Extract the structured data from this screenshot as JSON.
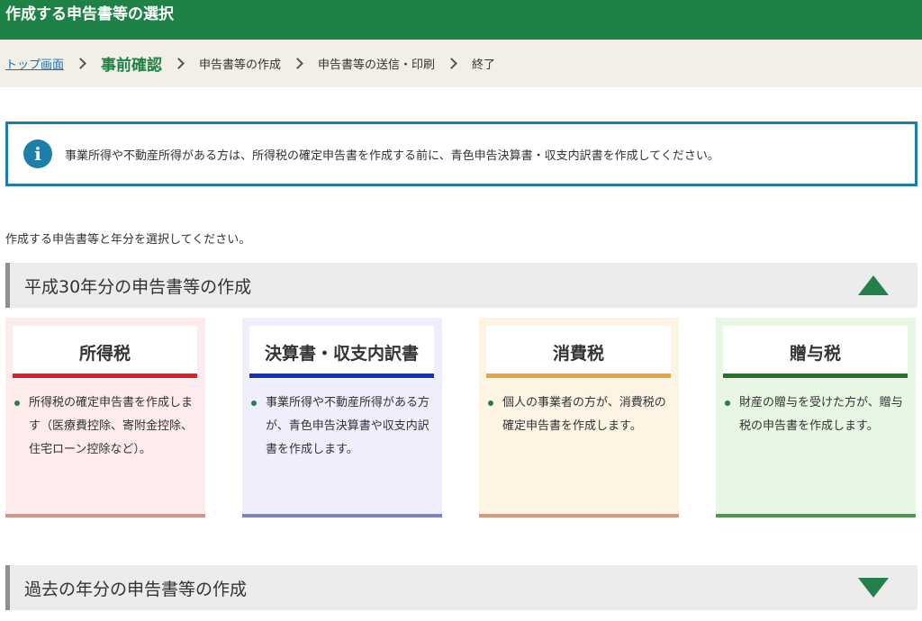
{
  "header": {
    "title": "作成する申告書等の選択"
  },
  "breadcrumb": {
    "items": [
      {
        "label": "トップ画面"
      },
      {
        "label": "事前確認"
      },
      {
        "label": "申告書等の作成"
      },
      {
        "label": "申告書等の送信・印刷"
      },
      {
        "label": "終了"
      }
    ]
  },
  "notice": {
    "icon": "info-icon",
    "icon_glyph": "i",
    "text": "事業所得や不動産所得がある方は、所得税の確定申告書を作成する前に、青色申告決算書・収支内訳書を作成してください。"
  },
  "instruction": "作成する申告書等と年分を選択してください。",
  "sections": [
    {
      "title": "平成30年分の申告書等の作成",
      "state": "expanded"
    },
    {
      "title": "過去の年分の申告書等の作成",
      "state": "collapsed"
    }
  ],
  "cards": [
    {
      "title": "所得税",
      "description": "所得税の確定申告書を作成します（医療費控除、寄附金控除、住宅ローン控除など）。",
      "colors": {
        "background": "#fdeceb",
        "accent": "#dd2027",
        "bottom": "#d5938e"
      }
    },
    {
      "title": "決算書・収支内訳書",
      "description": "事業所得や不動産所得がある方が、青色申告決算書や収支内訳書を作成します。",
      "colors": {
        "background": "#eeeefd",
        "accent": "#1131c9",
        "bottom": "#7f81c9"
      }
    },
    {
      "title": "消費税",
      "description": "個人の事業者の方が、消費税の確定申告書を作成します。",
      "colors": {
        "background": "#fdf4e4",
        "accent": "#e8a53a",
        "bottom": "#d39a7d"
      }
    },
    {
      "title": "贈与税",
      "description": "財産の贈与を受けた方が、贈与税の申告書を作成します。",
      "colors": {
        "background": "#e8f6e4",
        "accent": "#217a23",
        "bottom": "#4f9655"
      }
    }
  ],
  "colors": {
    "brand_green": "#1e8246",
    "breadcrumb_bg": "#f2f0e6",
    "link_blue": "#1a6fb0",
    "notice_border": "#1d7fa8",
    "section_bg": "#ececec"
  }
}
